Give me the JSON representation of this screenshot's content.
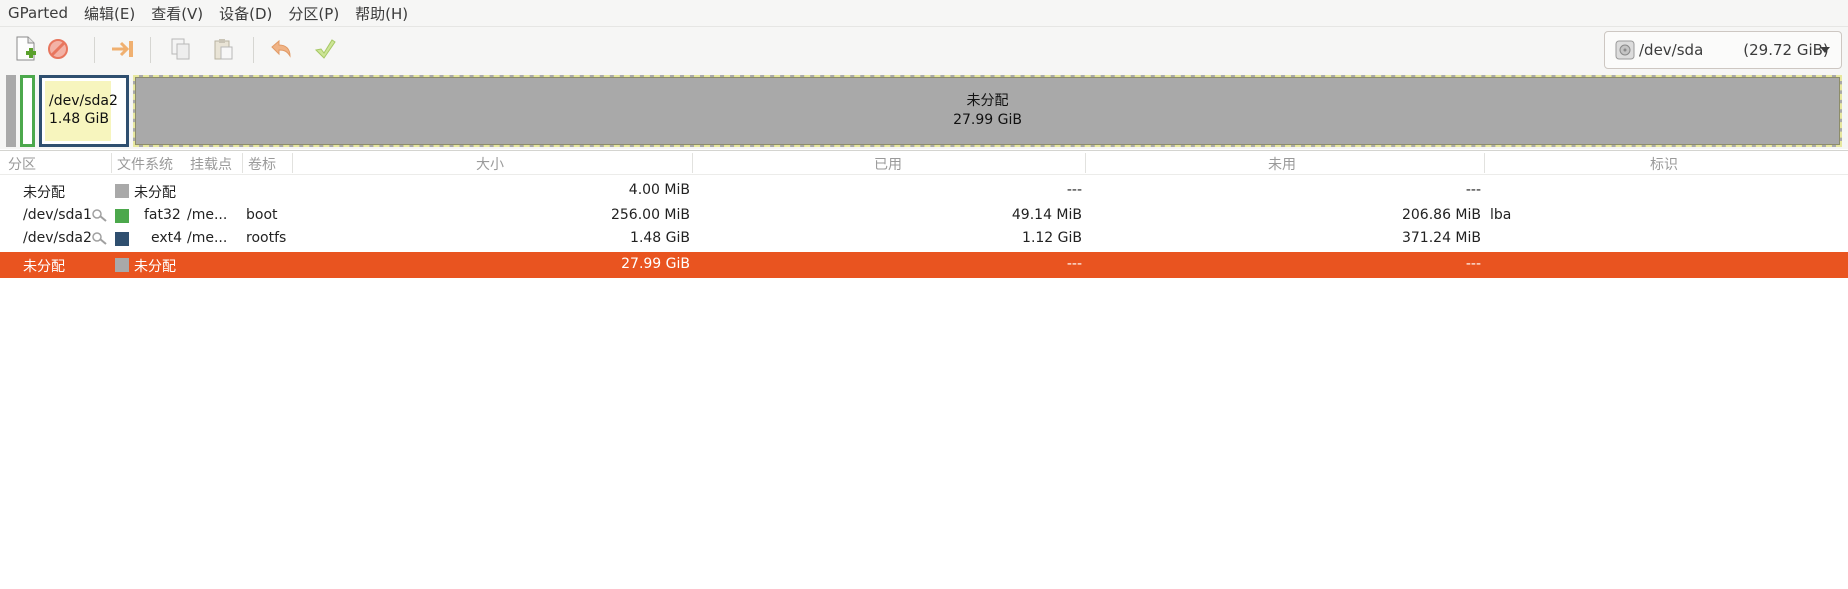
{
  "menu": {
    "items": [
      "GParted",
      "编辑(E)",
      "查看(V)",
      "设备(D)",
      "分区(P)",
      "帮助(H)"
    ]
  },
  "toolbar": {
    "buttons": [
      "new-partition",
      "delete-partition",
      "resize-move",
      "copy",
      "paste",
      "undo",
      "apply"
    ],
    "device_name": "/dev/sda",
    "device_size": "(29.72 GiB)"
  },
  "diskmap": {
    "sda2_name": "/dev/sda2",
    "sda2_size": "1.48 GiB",
    "unalloc_name": "未分配",
    "unalloc_size": "27.99 GiB"
  },
  "table": {
    "headers": {
      "partition": "分区",
      "filesystem": "文件系统",
      "mountpoint": "挂载点",
      "label": "卷标",
      "size": "大小",
      "used": "已用",
      "unused": "未用",
      "flags": "标识"
    },
    "rows": [
      {
        "partition": "未分配",
        "fs": "未分配",
        "fs_color": "#a9a9a9",
        "mount": "",
        "label": "",
        "size": "4.00 MiB",
        "used": "---",
        "unused": "---",
        "flags": "",
        "key": false,
        "selected": false
      },
      {
        "partition": "/dev/sda1",
        "fs": "fat32",
        "fs_color": "#4ca84c",
        "mount": "/me...",
        "label": "boot",
        "size": "256.00 MiB",
        "used": "49.14 MiB",
        "unused": "206.86 MiB",
        "flags": "lba",
        "key": true,
        "selected": false
      },
      {
        "partition": "/dev/sda2",
        "fs": "ext4",
        "fs_color": "#2f4f6f",
        "mount": "/me...",
        "label": "rootfs",
        "size": "1.48 GiB",
        "used": "1.12 GiB",
        "unused": "371.24 MiB",
        "flags": "",
        "key": true,
        "selected": false
      },
      {
        "partition": "未分配",
        "fs": "未分配",
        "fs_color": "#a9a9a9",
        "mount": "",
        "label": "",
        "size": "27.99 GiB",
        "used": "---",
        "unused": "---",
        "flags": "",
        "key": false,
        "selected": true
      }
    ]
  },
  "colors": {
    "accent": "#e95420",
    "unallocated": "#a9a9a9",
    "fat32": "#4ca84c",
    "ext4": "#2f4f6f",
    "used_space": "#f7f5be"
  }
}
